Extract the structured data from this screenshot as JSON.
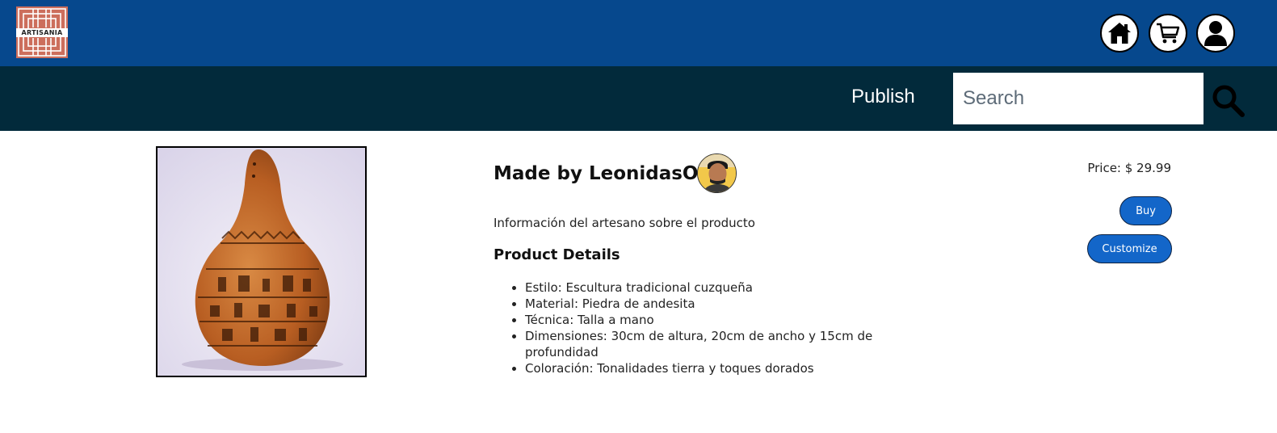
{
  "brand": {
    "logo_text": "ARTISANIA"
  },
  "header": {
    "icons": [
      "home-icon",
      "cart-icon",
      "user-icon"
    ],
    "colors": {
      "top_bar": "#06488d",
      "nav_bar": "#022a3b",
      "accent": "#1366c9"
    }
  },
  "nav": {
    "publish_label": "Publish",
    "search_placeholder": "Search"
  },
  "product": {
    "title": "Made by LeonidasOr",
    "info": "Información del artesano sobre el producto",
    "details_heading": "Product Details",
    "details": [
      "Estilo: Escultura tradicional cuzqueña",
      "Material: Piedra de andesita",
      "Técnica: Talla a mano",
      "Dimensiones: 30cm de altura, 20cm de ancho y 15cm de profundidad",
      "Coloración: Tonalidades tierra y toques dorados"
    ],
    "price": "Price: $ 29.99",
    "buy_label": "Buy",
    "customize_label": "Customize"
  }
}
